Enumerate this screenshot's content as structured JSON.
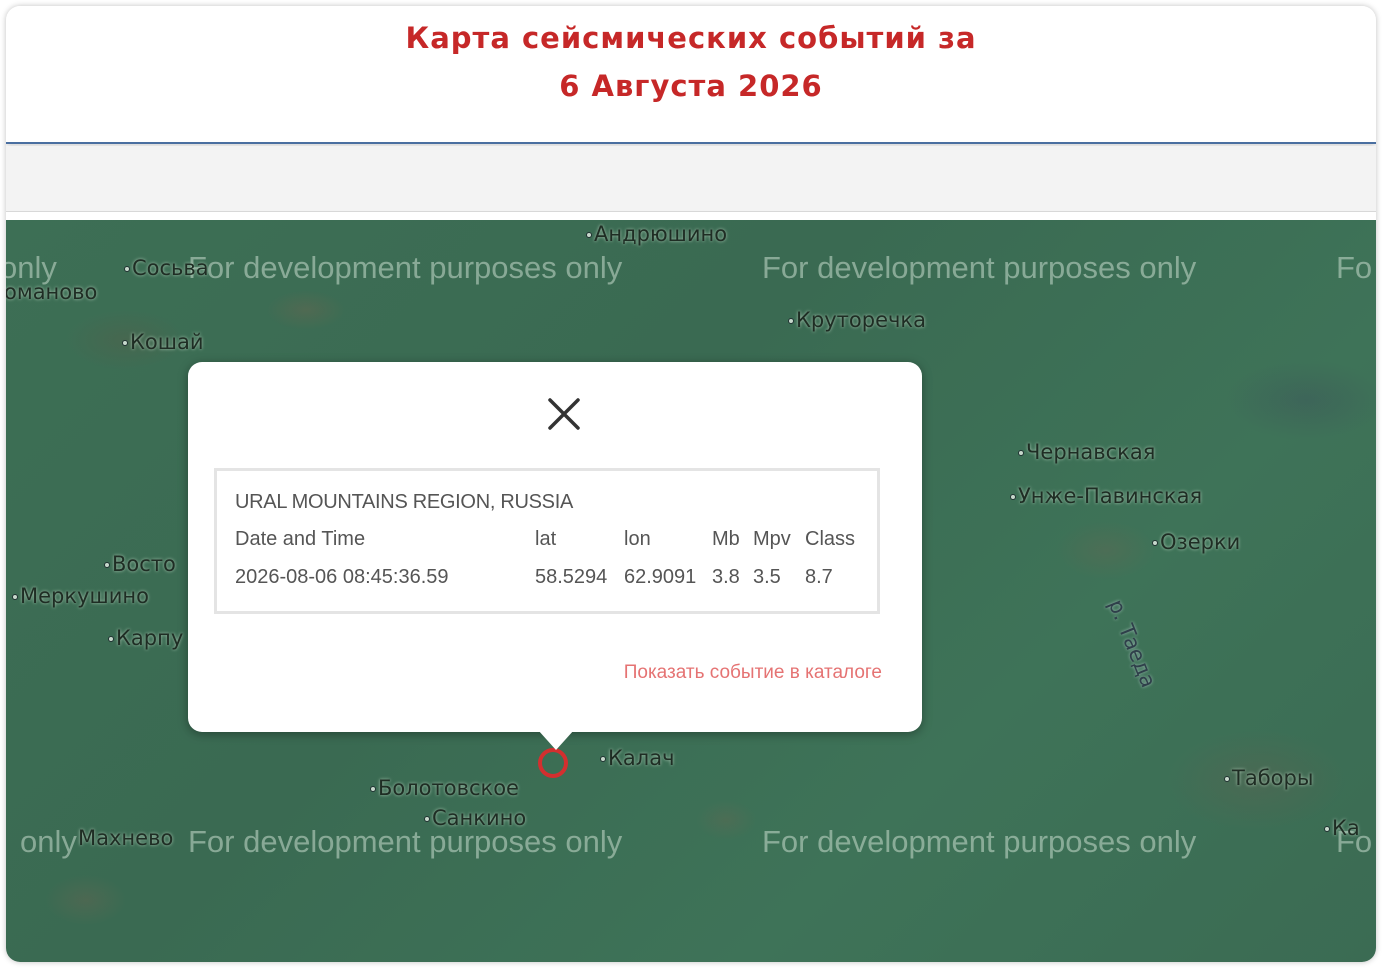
{
  "header": {
    "title_line1": "Карта сейсмических событий за",
    "title_line2": "6 Августа 2026",
    "title_color": "#c62828"
  },
  "map": {
    "watermark": "For development purposes only",
    "watermark_left_fragment": "only",
    "watermark_right_fragment": "Fo",
    "towns": {
      "andryushino": "Андрюшино",
      "sosva": "Сосьва",
      "romanovo": "омановo",
      "kryutorechka": "Круторечка",
      "koshay": "Кошай",
      "chernavskaya": "Чернавская",
      "unzhe_pavinskaya": "Унже-Павинская",
      "ozerki": "Озерки",
      "vostok": "Восто",
      "merkushino": "Меркушино",
      "karpy": "Карпу",
      "kalach": "Калач",
      "bolotovskoe": "Болотовское",
      "sankino": "Санкино",
      "makhnevo": "Махнево",
      "tabory": "Таборы",
      "ka": "Ка"
    },
    "river": "р. Таеда",
    "epicenter_color": "#d32f2f"
  },
  "popup": {
    "close_icon": "close-icon",
    "region": "URAL MOUNTAINS REGION, RUSSIA",
    "columns": {
      "datetime": "Date and Time",
      "lat": "lat",
      "lon": "lon",
      "mb": "Mb",
      "mpv": "Mpv",
      "class": "Class"
    },
    "event": {
      "datetime": "2026-08-06 08:45:36.59",
      "lat": "58.5294",
      "lon": "62.9091",
      "mb": "3.8",
      "mpv": "3.5",
      "class": "8.7"
    },
    "catalog_link": "Показать событие в каталоге",
    "link_color": "#e57373"
  }
}
